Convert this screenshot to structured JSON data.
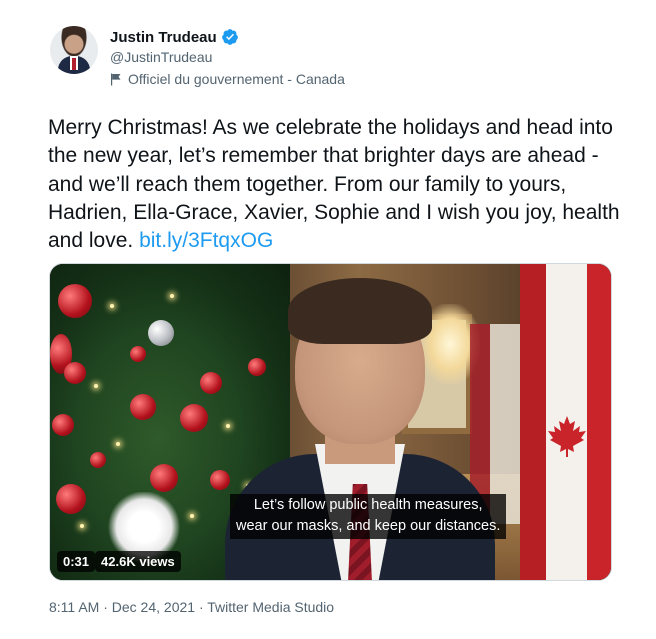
{
  "author": {
    "display_name": "Justin Trudeau",
    "handle": "@JustinTrudeau",
    "label": "Officiel du gouvernement - Canada",
    "verified_color": "#1d9bf0"
  },
  "tweet": {
    "text": "Merry Christmas! As we celebrate the holidays and head into the new year, let’s remember that brighter days are ahead - and we’ll reach them together. From our family to yours, Hadrien, Ella-Grace, Xavier, Sophie and I wish you joy, health and love. ",
    "link": "bit.ly/3FtqxOG",
    "link_color": "#1d9bf0"
  },
  "media": {
    "caption_line1": "Let’s follow public health measures,",
    "caption_line2": "wear our masks, and keep our distances.",
    "duration": "0:31",
    "views": "42.6K views"
  },
  "footer": {
    "timestamp": "8:11 AM · Dec 24, 2021 · Twitter Media Studio"
  }
}
